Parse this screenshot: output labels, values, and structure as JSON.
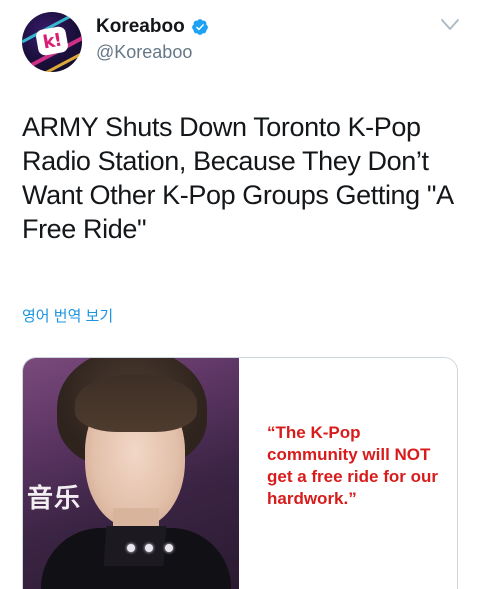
{
  "account": {
    "display_name": "Koreaboo",
    "handle": "@Koreaboo",
    "avatar_letter": "k!",
    "verified": true
  },
  "tweet": {
    "text": "ARMY Shuts Down Toronto K-Pop Radio Station, Because They Don’t Want Other K-Pop Groups Getting \"A Free Ride\"",
    "translate_label": "영어 번역 보기"
  },
  "card": {
    "photo_sign_text": "音乐",
    "quote": "“The K-Pop community will NOT get a free ride for our hardwork.”"
  },
  "icons": {
    "verified": "verified-badge-icon",
    "menu": "chevron-down-icon"
  },
  "colors": {
    "link": "#1b95e0",
    "verified": "#1da1f2",
    "secondary_text": "#657786",
    "quote_red": "#d81c1c"
  }
}
